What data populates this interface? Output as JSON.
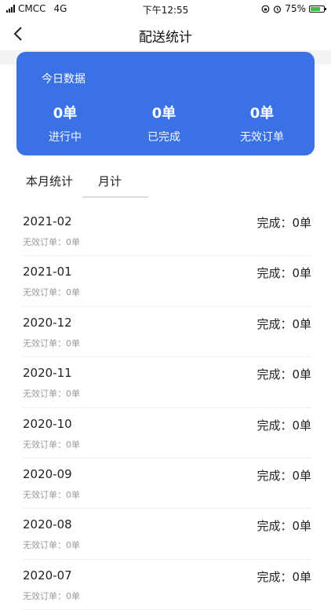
{
  "status_bar": {
    "carrier": "CMCC",
    "network": "4G",
    "time": "下午12:55",
    "battery": "75%",
    "battery_level": 0.75
  },
  "nav": {
    "title": "配送统计"
  },
  "today": {
    "title": "今日数据",
    "stats": [
      {
        "value": "0单",
        "label": "进行中"
      },
      {
        "value": "0单",
        "label": "已完成"
      },
      {
        "value": "0单",
        "label": "无效订单"
      }
    ]
  },
  "tabs": [
    {
      "label": "本月统计"
    },
    {
      "label": "月计"
    }
  ],
  "list": [
    {
      "month": "2021-02",
      "done": "完成：0单",
      "invalid": "无效订单：0单"
    },
    {
      "month": "2021-01",
      "done": "完成：0单",
      "invalid": "无效订单：0单"
    },
    {
      "month": "2020-12",
      "done": "完成：0单",
      "invalid": "无效订单：0单"
    },
    {
      "month": "2020-11",
      "done": "完成：0单",
      "invalid": "无效订单：0单"
    },
    {
      "month": "2020-10",
      "done": "完成：0单",
      "invalid": "无效订单：0单"
    },
    {
      "month": "2020-09",
      "done": "完成：0单",
      "invalid": "无效订单：0单"
    },
    {
      "month": "2020-08",
      "done": "完成：0单",
      "invalid": "无效订单：0单"
    },
    {
      "month": "2020-07",
      "done": "完成：0单",
      "invalid": "无效订单：0单"
    }
  ]
}
